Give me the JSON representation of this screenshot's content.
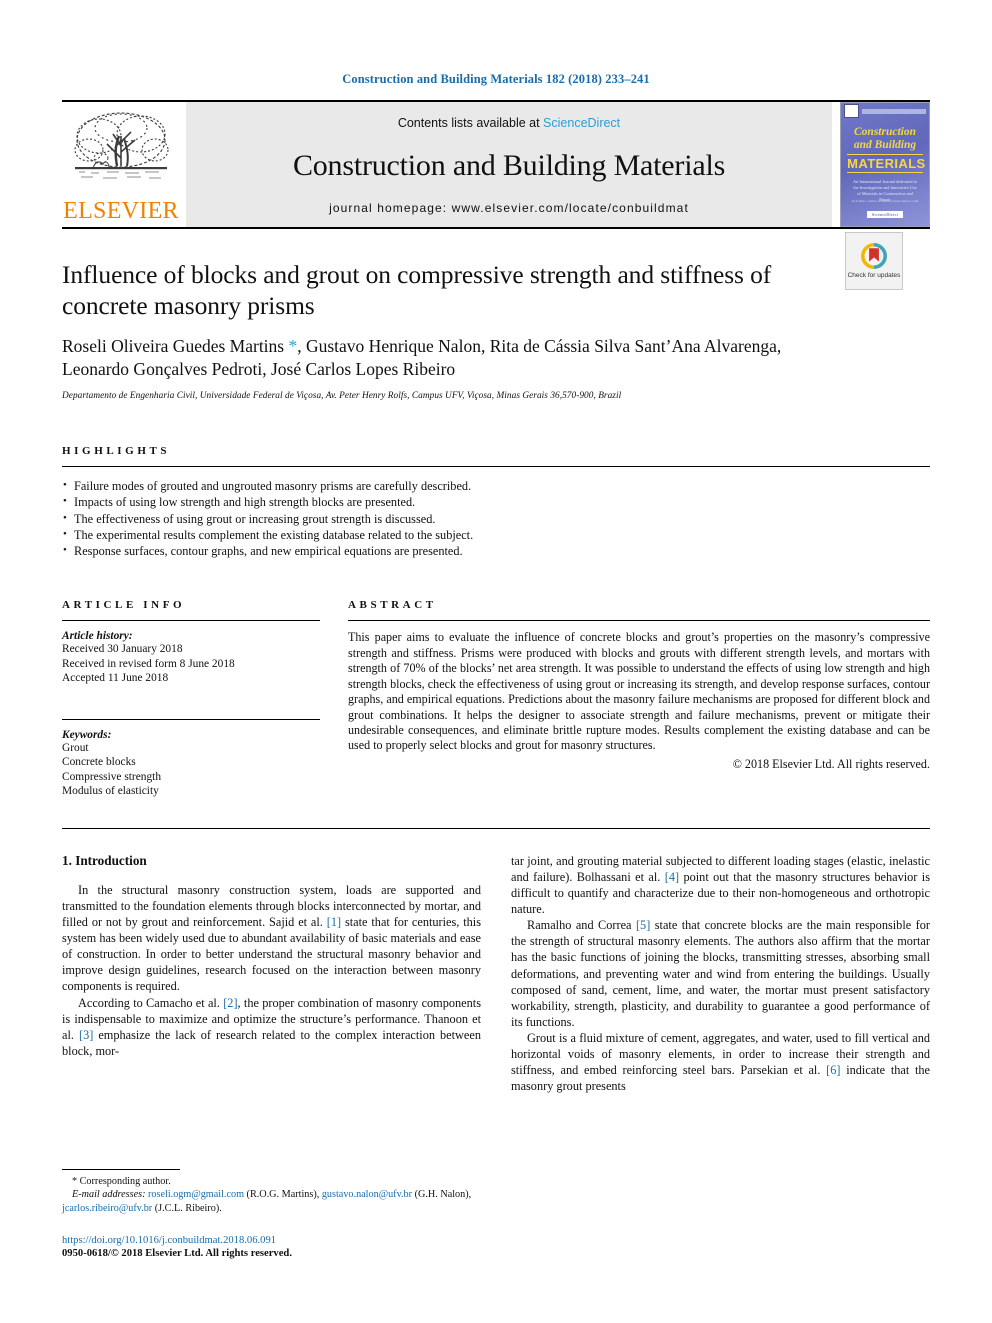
{
  "running_head": "Construction and Building Materials 182 (2018) 233–241",
  "masthead": {
    "publisher_name": "ELSEVIER",
    "contents_prefix": "Contents lists available at ",
    "contents_link": "ScienceDirect",
    "journal_title": "Construction and Building Materials",
    "homepage": "journal homepage: www.elsevier.com/locate/conbuildmat",
    "cover": {
      "line1": "Construction",
      "line2": "and Building",
      "line3": "MATERIALS",
      "blurb": "An International Journal dedicated to the Investigation and Innovative Use of Materials in Construction and Repair",
      "foot_line": "Available online at www.sciencedirect.com",
      "foot_box": "ScienceDirect"
    }
  },
  "article": {
    "title": "Influence of blocks and grout on compressive strength and stiffness of concrete masonry prisms",
    "authors": "Roseli Oliveira Guedes Martins *, Gustavo Henrique Nalon, Rita de Cássia Silva Sant’Ana Alvarenga, Leonardo Gonçalves Pedroti, José Carlos Lopes Ribeiro",
    "affiliation": "Departamento de Engenharia Civil, Universidade Federal de Viçosa, Av. Peter Henry Rolfs, Campus UFV, Viçosa, Minas Gerais 36,570-900, Brazil",
    "crossmark_label": "Check for updates"
  },
  "highlights": {
    "heading": "HIGHLIGHTS",
    "items": [
      "Failure modes of grouted and ungrouted masonry prisms are carefully described.",
      "Impacts of using low strength and high strength blocks are presented.",
      "The effectiveness of using grout or increasing grout strength is discussed.",
      "The experimental results complement the existing database related to the subject.",
      "Response surfaces, contour graphs, and new empirical equations are presented."
    ]
  },
  "article_info": {
    "heading": "ARTICLE INFO",
    "history_label": "Article history:",
    "history": [
      "Received 30 January 2018",
      "Received in revised form 8 June 2018",
      "Accepted 11 June 2018"
    ],
    "keywords_label": "Keywords:",
    "keywords": [
      "Grout",
      "Concrete blocks",
      "Compressive strength",
      "Modulus of elasticity"
    ]
  },
  "abstract": {
    "heading": "ABSTRACT",
    "text": "This paper aims to evaluate the influence of concrete blocks and grout’s properties on the masonry’s compressive strength and stiffness. Prisms were produced with blocks and grouts with different strength levels, and mortars with strength of 70% of the blocks’ net area strength. It was possible to understand the effects of using low strength and high strength blocks, check the effectiveness of using grout or increasing its strength, and develop response surfaces, contour graphs, and empirical equations. Predictions about the masonry failure mechanisms are proposed for different block and grout combinations. It helps the designer to associate strength and failure mechanisms, prevent or mitigate their undesirable consequences, and eliminate brittle rupture modes. Results complement the existing database and can be used to properly select blocks and grout for masonry structures.",
    "copyright": "© 2018 Elsevier Ltd. All rights reserved."
  },
  "body": {
    "section_title": "1. Introduction",
    "left_paragraphs": [
      "In the structural masonry construction system, loads are supported and transmitted to the foundation elements through blocks interconnected by mortar, and filled or not by grout and reinforcement. Sajid et al. [1] state that for centuries, this system has been widely used due to abundant availability of basic materials and ease of construction. In order to better understand the structural masonry behavior and improve design guidelines, research focused on the interaction between masonry components is required.",
      "According to Camacho et al. [2], the proper combination of masonry components is indispensable to maximize and optimize the structure’s performance. Thanoon et al. [3] emphasize the lack of research related to the complex interaction between block, mor-"
    ],
    "right_paragraphs": [
      "tar joint, and grouting material subjected to different loading stages (elastic, inelastic and failure). Bolhassani et al. [4] point out that the masonry structures behavior is difficult to quantify and characterize due to their non-homogeneous and orthotropic nature.",
      "Ramalho and Correa [5] state that concrete blocks are the main responsible for the strength of structural masonry elements. The authors also affirm that the mortar has the basic functions of joining the blocks, transmitting stresses, absorbing small deformations, and preventing water and wind from entering the buildings. Usually composed of sand, cement, lime, and water, the mortar must present satisfactory workability, strength, plasticity, and durability to guarantee a good performance of its functions.",
      "Grout is a fluid mixture of cement, aggregates, and water, used to fill vertical and horizontal voids of masonry elements, in order to increase their strength and stiffness, and embed reinforcing steel bars. Parsekian et al. [6] indicate that the masonry grout presents"
    ]
  },
  "footnotes": {
    "corresponding": "* Corresponding author.",
    "email_label": "E-mail addresses:",
    "email1": "roseli.ogm@gmail.com",
    "email1_owner": " (R.O.G. Martins), ",
    "email2": "gustavo.nalon@ufv.br",
    "email2_owner": " (G.H. Nalon), ",
    "email3": "jcarlos.ribeiro@ufv.br",
    "email3_owner": " (J.C.L. Ribeiro).",
    "doi": "https://doi.org/10.1016/j.conbuildmat.2018.06.091",
    "issn": "0950-0618/© 2018 Elsevier Ltd. All rights reserved."
  },
  "colors": {
    "link_blue": "#1b6ca8",
    "sciencedirect_blue": "#2a9fd6",
    "elsevier_orange": "#ef8200",
    "cover_blue": "#6b74c4",
    "cover_yellow": "#f5d742"
  }
}
